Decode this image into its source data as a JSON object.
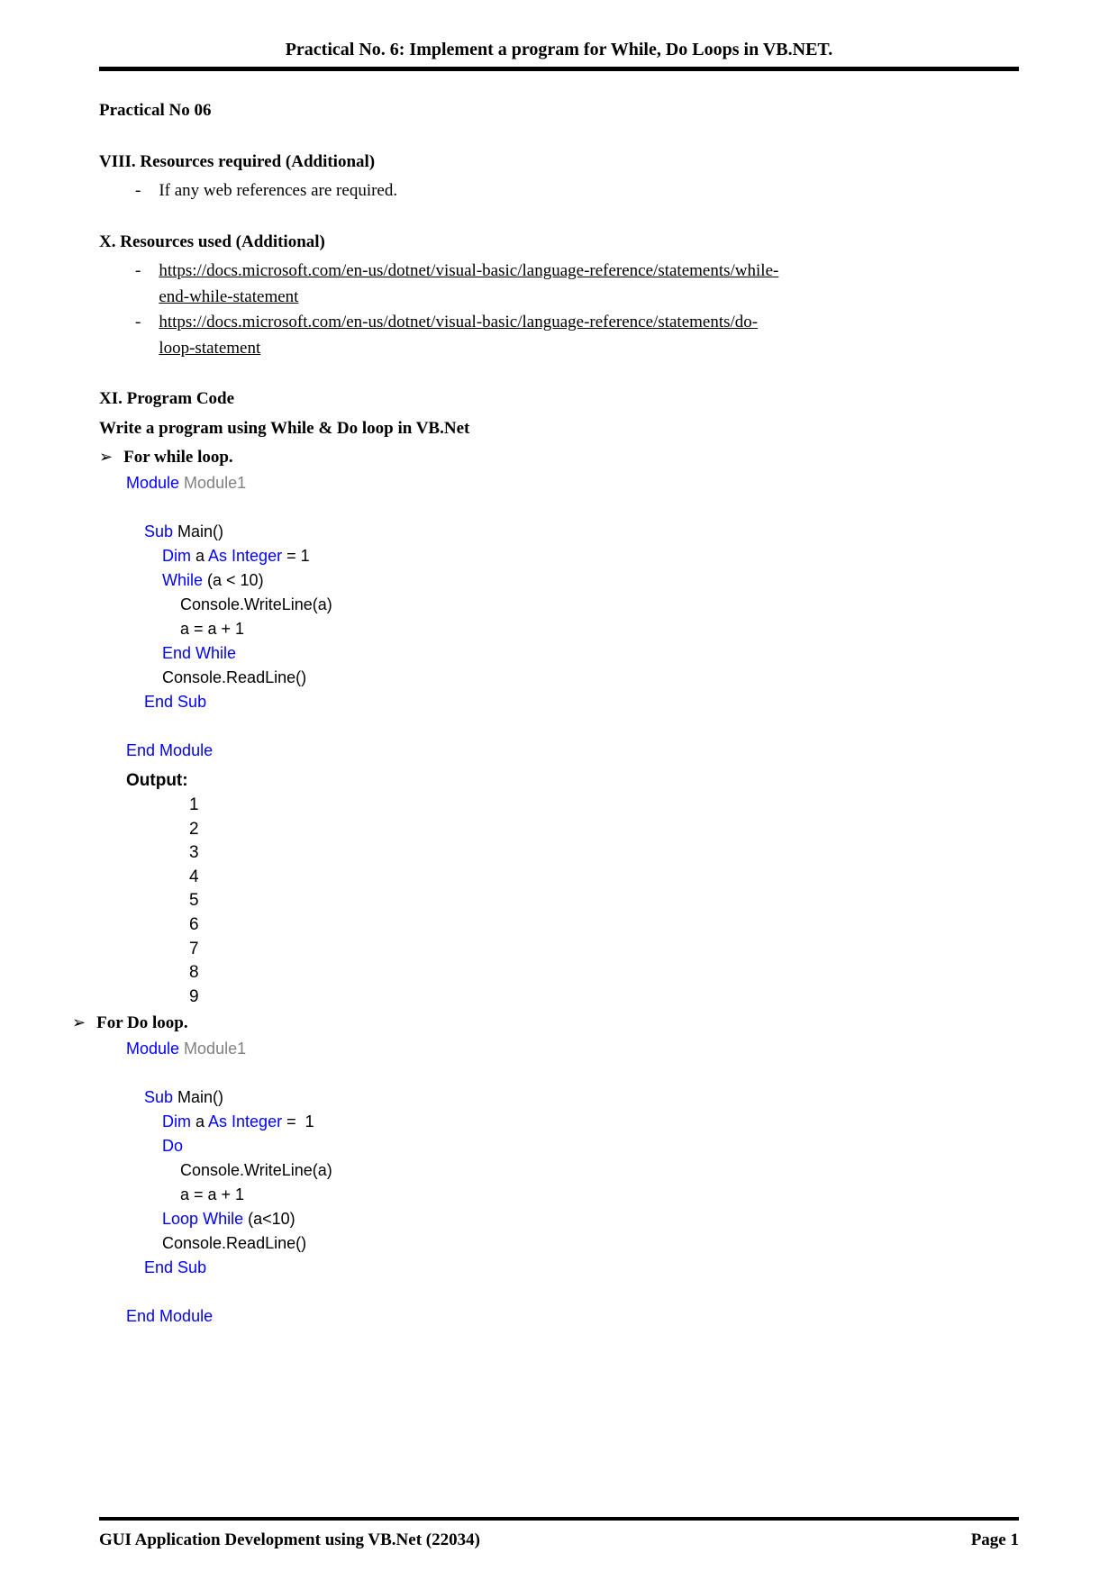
{
  "header": {
    "title": "Practical No. 6: Implement a program for While, Do Loops in VB.NET."
  },
  "sections": {
    "practical_no": "Practical No 06",
    "resources_required": {
      "heading": "VIII. Resources required (Additional)",
      "item": "If any web references are required."
    },
    "resources_used": {
      "heading": "X. Resources used (Additional)",
      "link1_part1": "https://docs.microsoft.com/en-us/dotnet/visual-basic/language-reference/statements/while-",
      "link1_part2": "end-while-statement",
      "link2_part1": "https://docs.microsoft.com/en-us/dotnet/visual-basic/language-reference/statements/do-",
      "link2_part2": "loop-statement"
    },
    "program_code": {
      "heading": "XI. Program Code",
      "subheading": "Write a program using While & Do loop in VB.Net",
      "while_loop": {
        "label": "For while loop.",
        "output_label": "Output:"
      },
      "do_loop": {
        "label": "For Do loop."
      }
    }
  },
  "code_while": {
    "line1_a": "Module",
    "line1_b": " Module1",
    "line2_a": "    Sub",
    "line2_b": " Main()",
    "line3_a": "        Dim",
    "line3_b": " a ",
    "line3_c": "As Integer",
    "line3_d": " = 1",
    "line4_a": "        While",
    "line4_b": " (a < 10)",
    "line5": "            Console.WriteLine(a)",
    "line6": "            a = a + 1",
    "line7": "        End While",
    "line8": "        Console.ReadLine()",
    "line9_a": "    End",
    "line9_b": " ",
    "line9_c": "Sub",
    "line10_a": "End",
    "line10_b": " ",
    "line10_c": "Module"
  },
  "output_while": {
    "l1": "1",
    "l2": "2",
    "l3": "3",
    "l4": "4",
    "l5": "5",
    "l6": "6",
    "l7": "7",
    "l8": "8",
    "l9": "9"
  },
  "code_do": {
    "line1_a": "Module",
    "line1_b": " Module1",
    "line2_a": "    Sub",
    "line2_b": " Main()",
    "line3_a": "        Dim",
    "line3_b": " a ",
    "line3_c": "As Integer",
    "line3_d": " = ",
    "line3_e": " 1",
    "line4": "        Do",
    "line5": "            Console.WriteLine(a)",
    "line6": "            a = a + 1",
    "line7_a": "        Loop",
    "line7_b": " ",
    "line7_c": "While",
    "line7_d": " (a<10)",
    "line8": "        Console.ReadLine()",
    "line9_a": "    End",
    "line9_b": " ",
    "line9_c": "Sub",
    "line10_a": "End",
    "line10_b": " ",
    "line10_c": "Module"
  },
  "footer": {
    "left": "GUI Application Development using VB.Net (22034)",
    "right": "Page 1"
  }
}
